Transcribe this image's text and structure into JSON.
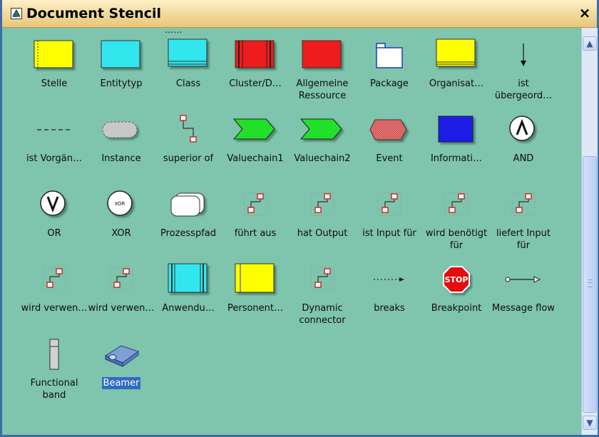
{
  "window": {
    "title": "Document Stencil",
    "close_glyph": "×"
  },
  "clipped_text": "……",
  "scrollbar": {
    "up_glyph": "▲",
    "down_glyph": "▼"
  },
  "items": [
    {
      "label": "Stelle",
      "icon": "stelle-shape-icon"
    },
    {
      "label": "Entitytyp",
      "icon": "entitytyp-shape-icon"
    },
    {
      "label": "Class",
      "icon": "class-shape-icon"
    },
    {
      "label": "Cluster/D…",
      "icon": "cluster-shape-icon"
    },
    {
      "label": "Allgemeine Ressource",
      "icon": "allgemeine-ressource-shape-icon"
    },
    {
      "label": "Package",
      "icon": "package-folder-icon"
    },
    {
      "label": "Organisat…",
      "icon": "organisation-shape-icon"
    },
    {
      "label": "ist übergeord…",
      "icon": "arrow-down-icon"
    },
    {
      "label": "ist Vorgän…",
      "icon": "dashed-line-icon"
    },
    {
      "label": "Instance",
      "icon": "instance-shape-icon"
    },
    {
      "label": "superior of",
      "icon": "connector-icon"
    },
    {
      "label": "Valuechain1",
      "icon": "valuechain-arrow-icon"
    },
    {
      "label": "Valuechain2",
      "icon": "valuechain-arrow-icon"
    },
    {
      "label": "Event",
      "icon": "event-hexagon-icon"
    },
    {
      "label": "Informati…",
      "icon": "information-shape-icon"
    },
    {
      "label": "AND",
      "icon": "and-operator-icon"
    },
    {
      "label": "OR",
      "icon": "or-operator-icon"
    },
    {
      "label": "XOR",
      "icon": "xor-operator-icon"
    },
    {
      "label": "Prozesspfad",
      "icon": "prozesspfad-shape-icon"
    },
    {
      "label": "führt aus",
      "icon": "dynamic-connector-icon"
    },
    {
      "label": "hat Output",
      "icon": "dynamic-connector-icon"
    },
    {
      "label": "ist Input für",
      "icon": "dynamic-connector-icon"
    },
    {
      "label": "wird benötigt für",
      "icon": "dynamic-connector-icon"
    },
    {
      "label": "liefert Input für",
      "icon": "dynamic-connector-icon"
    },
    {
      "label": "wird verwen…",
      "icon": "dynamic-connector-icon"
    },
    {
      "label": "wird verwen…",
      "icon": "dynamic-connector-icon"
    },
    {
      "label": "Anwendu…",
      "icon": "anwendung-shape-icon"
    },
    {
      "label": "Personent…",
      "icon": "personentyp-shape-icon"
    },
    {
      "label": "Dynamic connector",
      "icon": "dynamic-connector-icon"
    },
    {
      "label": "breaks",
      "icon": "dotted-arrow-icon"
    },
    {
      "label": "Breakpoint",
      "icon": "stop-sign-icon"
    },
    {
      "label": "Message flow",
      "icon": "message-flow-arrow-icon"
    },
    {
      "label": "Functional band",
      "icon": "functional-band-icon"
    },
    {
      "label": "Beamer",
      "icon": "beamer-projector-icon",
      "selected": true
    }
  ],
  "colors": {
    "background": "#7fc4ac",
    "title_bar": "#f2d89a",
    "selection": "#316ac5"
  }
}
